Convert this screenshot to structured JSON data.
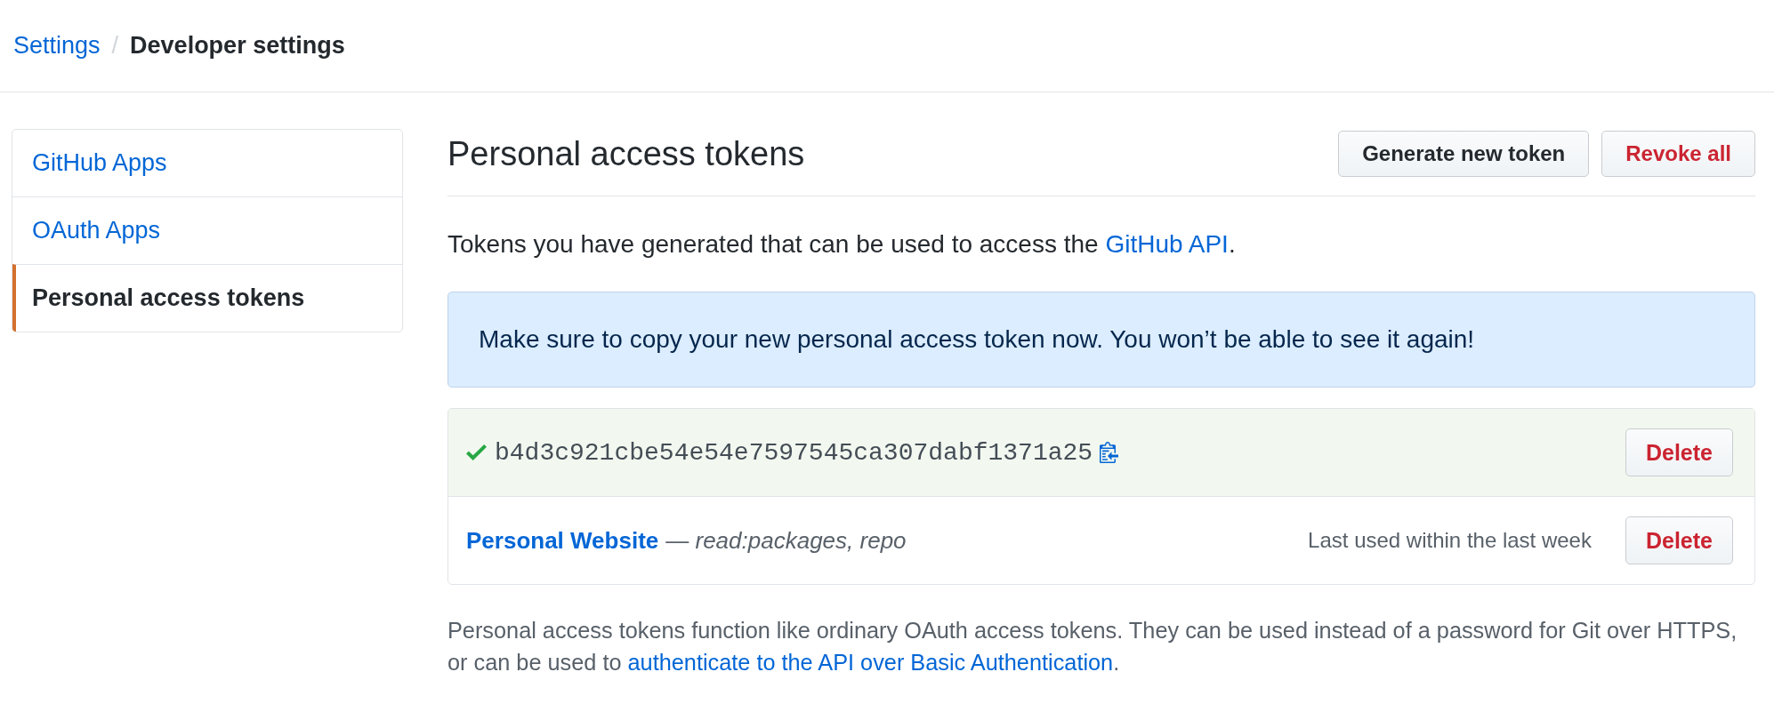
{
  "breadcrumb": {
    "separator": "/",
    "items": [
      {
        "label": "Settings",
        "kind": "link"
      },
      {
        "label": "Developer settings",
        "kind": "current"
      }
    ]
  },
  "sidebar": {
    "items": [
      {
        "label": "GitHub Apps",
        "selected": false
      },
      {
        "label": "OAuth Apps",
        "selected": false
      },
      {
        "label": "Personal access tokens",
        "selected": true
      }
    ]
  },
  "main": {
    "title": "Personal access tokens",
    "buttons": [
      {
        "label": "Generate new token",
        "kind": "default"
      },
      {
        "label": "Revoke all",
        "kind": "danger"
      }
    ],
    "intro": {
      "text": "Tokens you have generated that can be used to access the",
      "link": "GitHub API",
      "end": "."
    },
    "flash": {
      "text": "Make sure to copy your new personal access token now. You won’t be able to see it again!"
    },
    "tokens": [
      {
        "kind": "new",
        "value": "b4d3c921cbe54e54e7597545ca307dabf1371a25",
        "button": "Delete"
      },
      {
        "kind": "existing",
        "name": "Personal Website",
        "scopes": "— *read:packages, repo*",
        "last_used": "Last used within the last week",
        "button": "Delete"
      }
    ],
    "footer": {
      "text": "Personal access tokens function like ordinary OAuth access tokens. They can be used instead of a password for Git over HTTPS, or can be used to",
      "link": "authenticate to the API over Basic Authentication",
      "end": "."
    }
  }
}
